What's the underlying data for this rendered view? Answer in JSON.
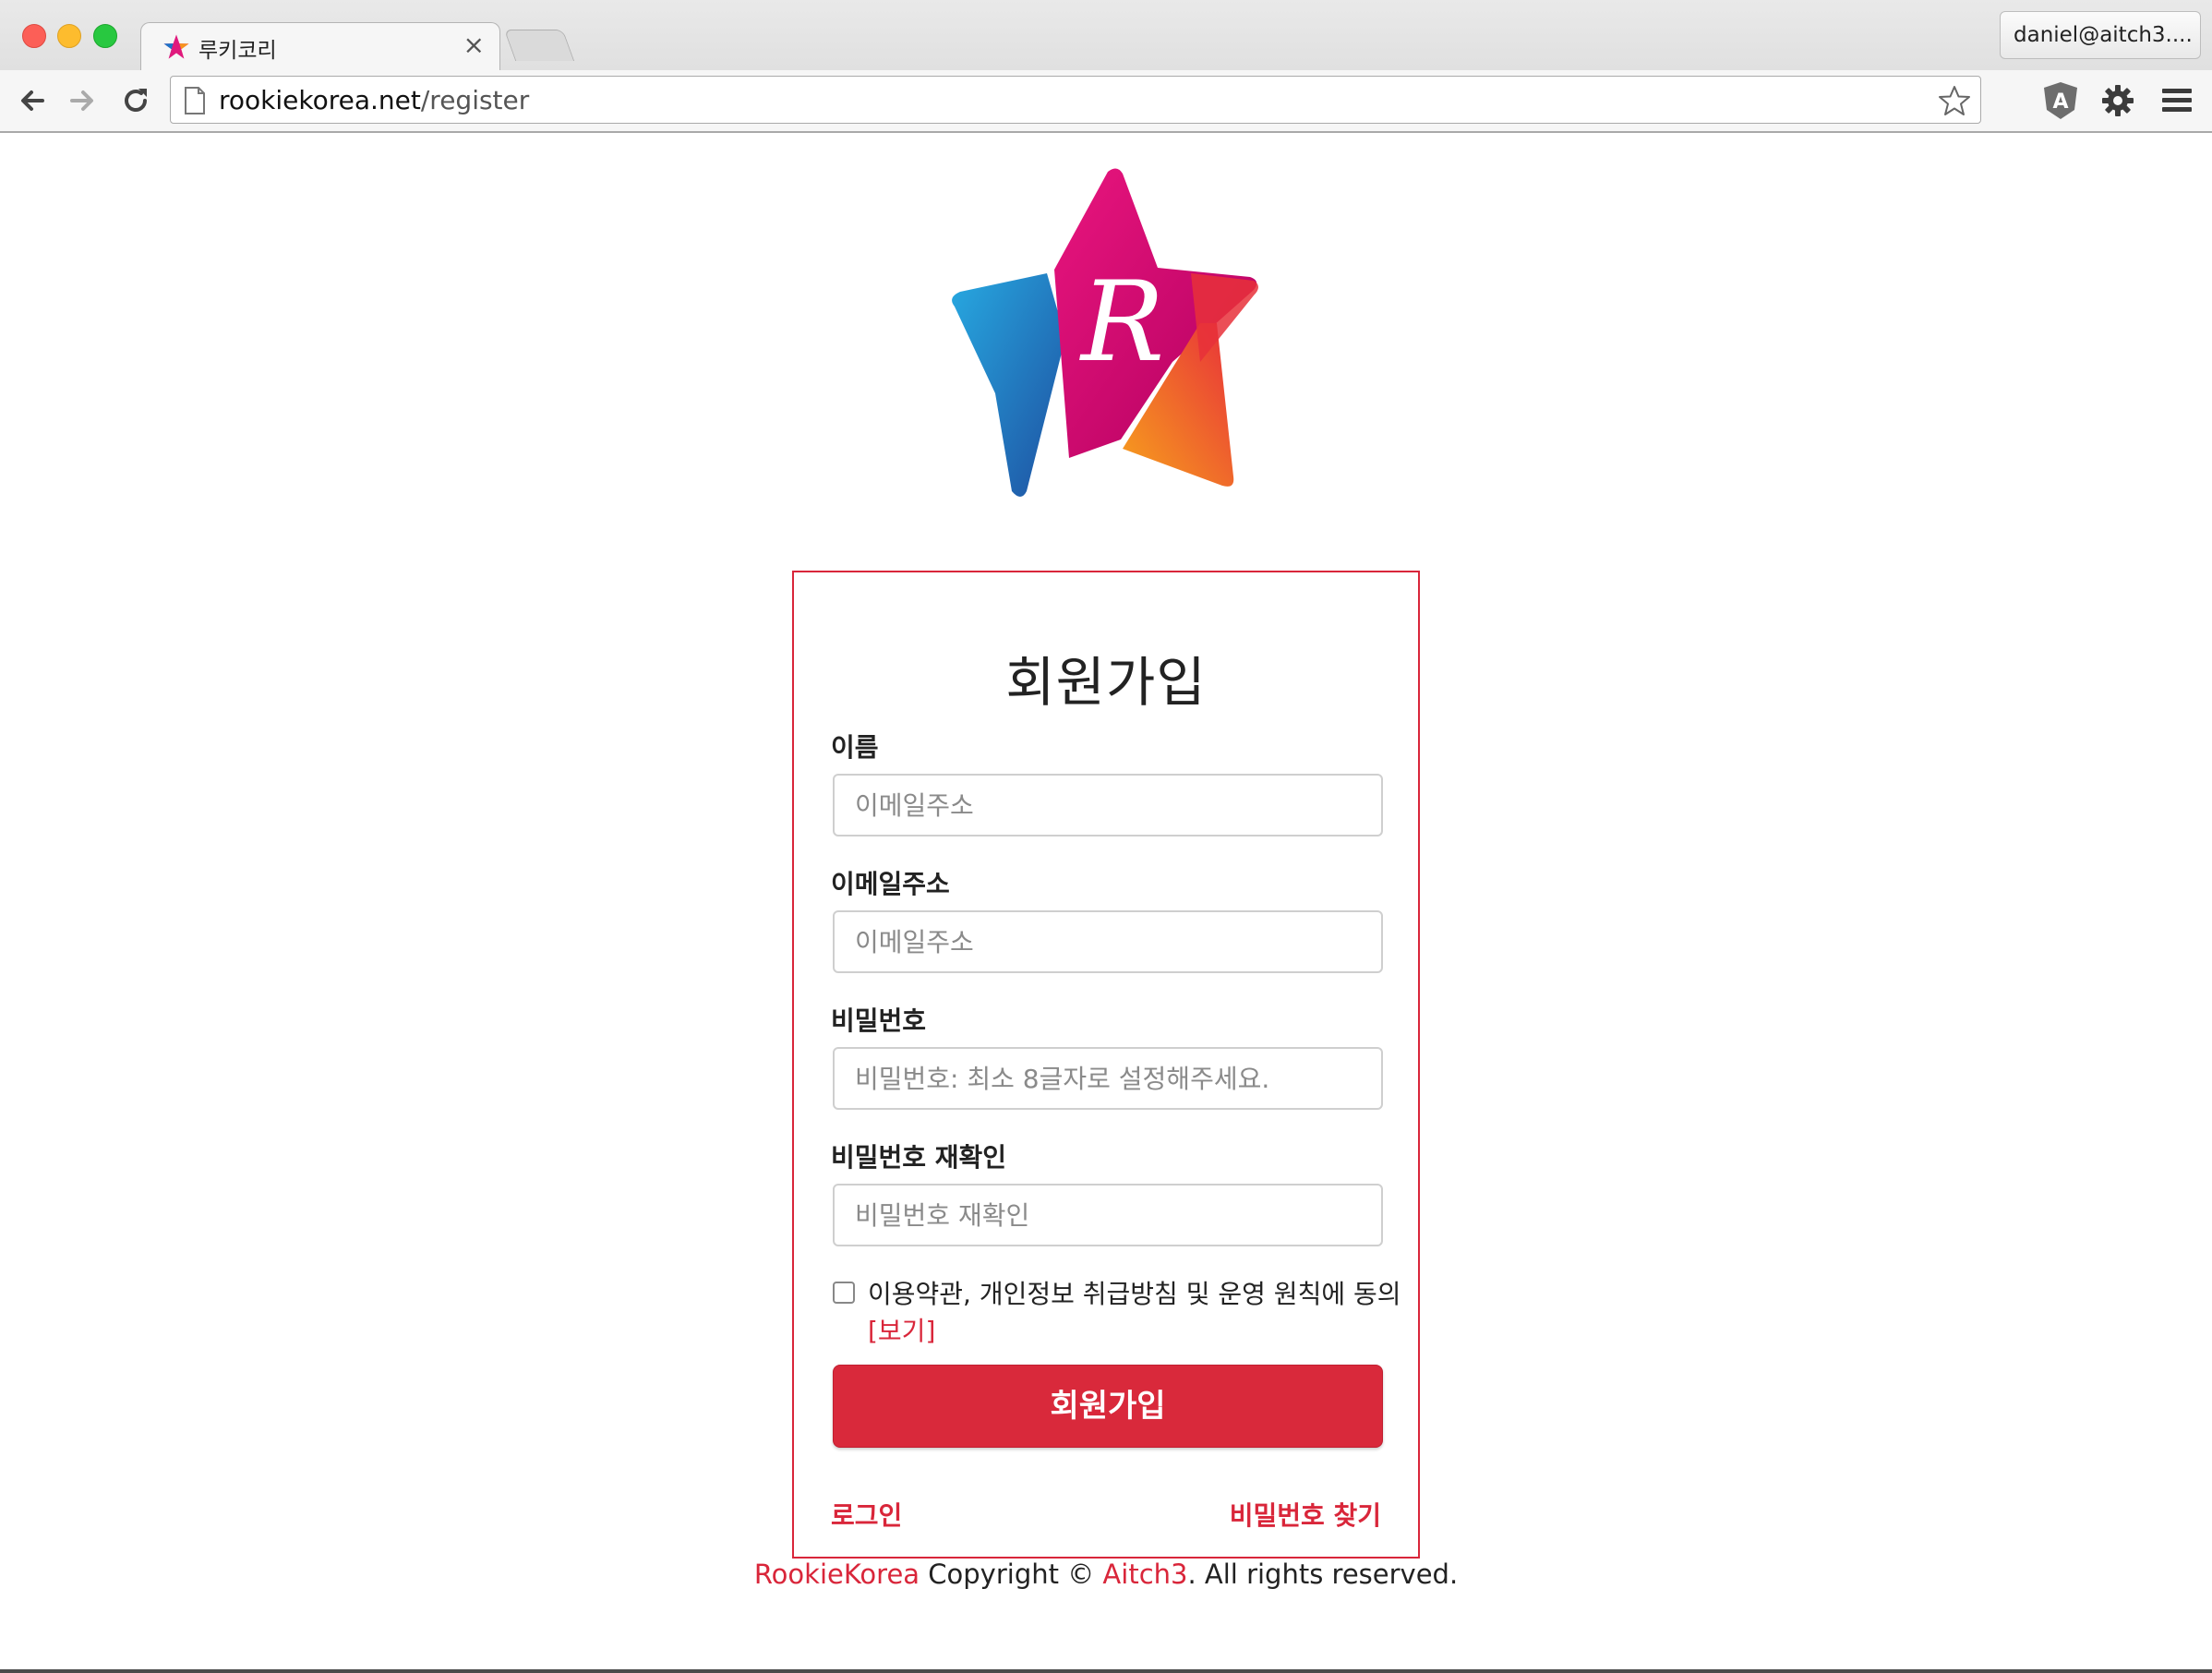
{
  "browser": {
    "tab_title": "루키코리",
    "tab_close": "×",
    "profile_name": "daniel@aitch3....",
    "url_host": "rookiekorea.net",
    "url_path": "/register",
    "icons": [
      "back-icon",
      "forward-icon",
      "reload-icon",
      "page-icon",
      "bookmark-star-icon",
      "angular-extension-icon",
      "settings-gear-icon",
      "menu-icon"
    ]
  },
  "brand": {
    "logo_letter": "R",
    "colors": {
      "magenta": "#e0197d",
      "blue": "#1a73c8",
      "orange": "#f7941d",
      "accent_red": "#d9263a"
    }
  },
  "form": {
    "title": "회원가입",
    "fields": [
      {
        "label": "이름",
        "placeholder": "이메일주소",
        "value": ""
      },
      {
        "label": "이메일주소",
        "placeholder": "이메일주소",
        "value": ""
      },
      {
        "label": "비밀번호",
        "placeholder": "비밀번호: 최소 8글자로 설정해주세요.",
        "value": ""
      },
      {
        "label": "비밀번호 재확인",
        "placeholder": "비밀번호 재확인",
        "value": ""
      }
    ],
    "agree_text": "이용약관, 개인정보 취급방침 및 운영 원칙에 동의",
    "agree_link": "[보기]",
    "submit_label": "회원가입",
    "login_link": "로그인",
    "find_password_link": "비밀번호 찾기"
  },
  "footer": {
    "brand": "RookieKorea",
    "copyright": " Copyright © ",
    "company": "Aitch3",
    "rights": ". All rights reserved."
  }
}
